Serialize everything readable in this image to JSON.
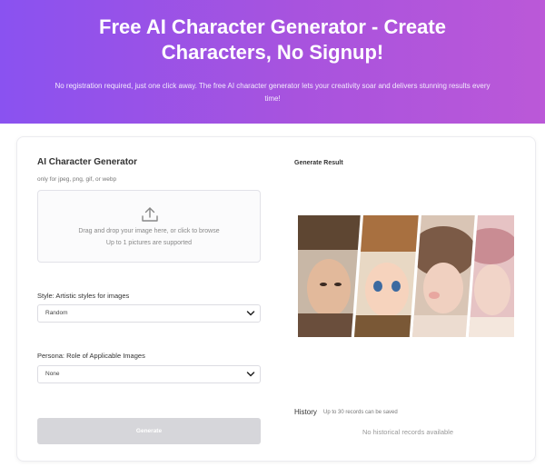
{
  "hero": {
    "title": "Free AI Character Generator - Create Characters, No Signup!",
    "subtitle": "No registration required, just one click away. The free AI character generator lets your creativity soar and delivers stunning results every time!",
    "gradient_start": "#8a52f0",
    "gradient_end": "#bb58d8"
  },
  "generator": {
    "title": "AI Character Generator",
    "file_hint": "only for jpeg, png, gif, or webp",
    "upload": {
      "icon": "upload-icon",
      "main_text": "Drag and drop your image here, or click to browse",
      "sub_text": "Up to 1 pictures are supported"
    },
    "style": {
      "label": "Style: Artistic styles for images",
      "value": "Random"
    },
    "persona": {
      "label": "Persona: Role of Applicable Images",
      "value": "None"
    },
    "generate_label": "Generate"
  },
  "result": {
    "title": "Generate Result"
  },
  "history": {
    "title": "History",
    "note": "Up to 30 records can be saved",
    "empty": "No historical records available"
  }
}
